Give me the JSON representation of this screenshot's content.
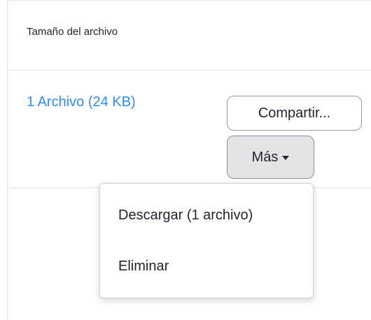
{
  "table": {
    "column_header": "Tamaño del archivo",
    "file_link": "1 Archivo (24 KB)"
  },
  "actions": {
    "share_label": "Compartir...",
    "more_label": "Más"
  },
  "dropdown": {
    "items": [
      {
        "label": "Descargar (1 archivo)"
      },
      {
        "label": "Eliminar"
      }
    ]
  },
  "colors": {
    "link": "#2d8cff",
    "text": "#232333",
    "border": "#e4e4e9",
    "more_button_bg": "#e4e4e7"
  },
  "icons": {
    "more_caret": "caret-down-icon"
  }
}
